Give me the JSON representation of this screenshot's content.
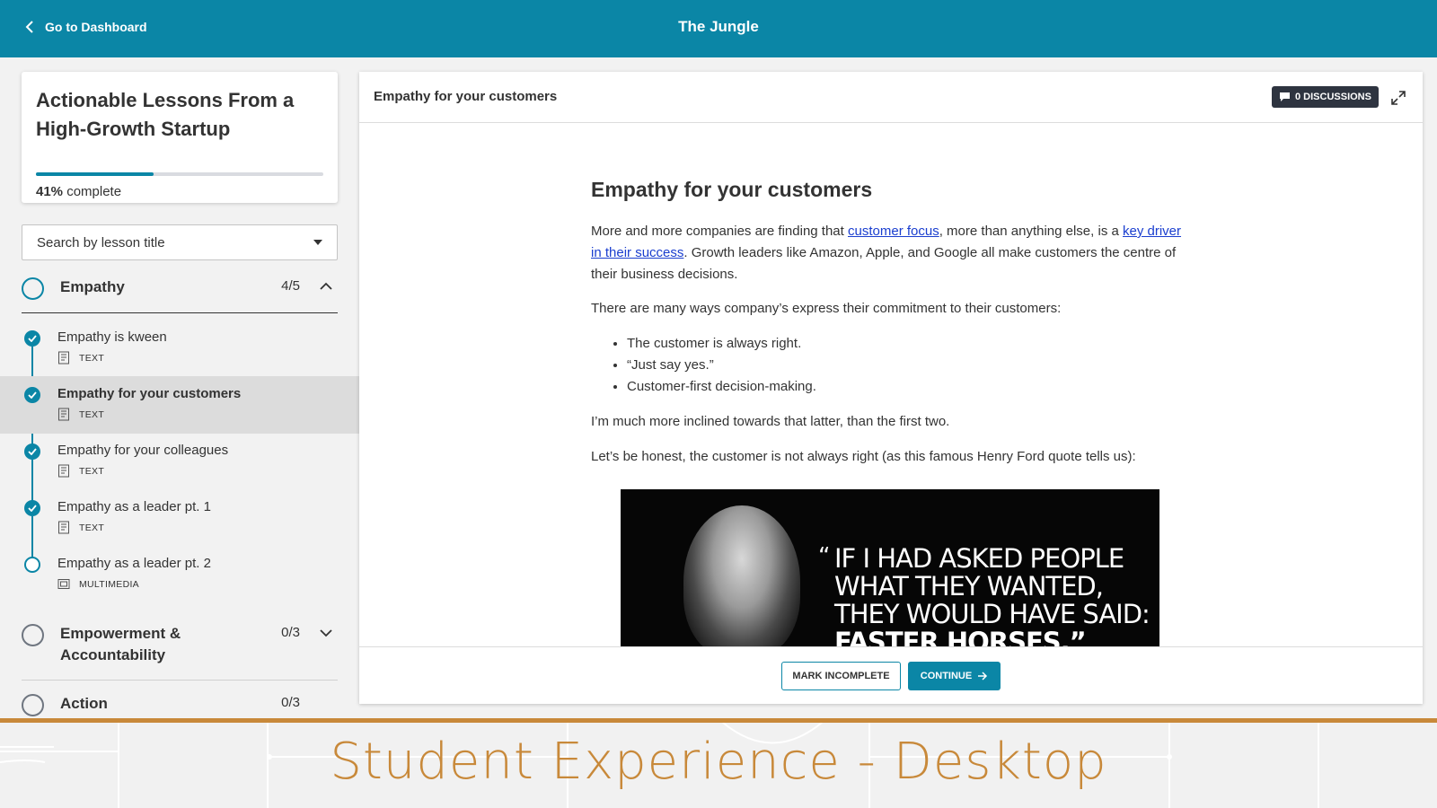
{
  "topbar": {
    "back_label": "Go to Dashboard",
    "course_title": "The Jungle"
  },
  "course": {
    "name": "Actionable Lessons From a High-Growth Startup",
    "progress_percent": 41,
    "progress_value": "41%",
    "progress_suffix": " complete"
  },
  "search": {
    "label": "Search by lesson title"
  },
  "modules": [
    {
      "name": "Empathy",
      "count": "4/5",
      "expanded": true
    },
    {
      "name": "Empowerment & Accountability",
      "count": "0/3",
      "expanded": false
    },
    {
      "name": "Action",
      "count": "0/3",
      "expanded": false
    }
  ],
  "lessons": [
    {
      "title": "Empathy is kween",
      "type": "TEXT",
      "completed": true
    },
    {
      "title": "Empathy for your customers",
      "type": "TEXT",
      "completed": true,
      "current": true
    },
    {
      "title": "Empathy for your colleagues",
      "type": "TEXT",
      "completed": true
    },
    {
      "title": "Empathy as a leader pt. 1",
      "type": "TEXT",
      "completed": true
    },
    {
      "title": "Empathy as a leader pt. 2",
      "type": "MULTIMEDIA",
      "completed": false
    }
  ],
  "content": {
    "header_title": "Empathy for your customers",
    "discussions_label": "0 DISCUSSIONS",
    "article_title": "Empathy for your customers",
    "p1_before": "More and more companies are finding that ",
    "p1_link1": "customer focus",
    "p1_mid": ", more than anything else, is a ",
    "p1_link2": "key driver in their success",
    "p1_after": ". Growth leaders like Amazon, Apple, and Google all make customers the centre of their business decisions.",
    "p2": "There are many ways company’s express their commitment to their customers:",
    "bullets": [
      "The customer is always right.",
      "“Just say yes.”",
      "Customer-first decision-making."
    ],
    "p3": "I’m much more inclined towards that latter, than the first two.",
    "p4": "Let’s be honest, the customer is not always right (as this famous Henry Ford quote tells us):",
    "quote_lines": [
      "IF I HAD ASKED PEOPLE",
      "WHAT THEY WANTED,",
      "THEY WOULD HAVE SAID:",
      "FASTER HORSES.”"
    ],
    "mark_incomplete_label": "MARK INCOMPLETE",
    "continue_label": "CONTINUE"
  },
  "banner": {
    "text": "Student Experience - Desktop",
    "accent_color": "#c8893a"
  },
  "colors": {
    "brand": "#0b86a6",
    "dark_badge": "#2e3440"
  },
  "icons": {
    "back": "chevron-left-icon",
    "module_expanded": "chevron-up-icon",
    "module_collapsed": "chevron-down-icon",
    "lesson_complete": "check-circle-icon",
    "lesson_text": "document-icon",
    "lesson_multimedia": "media-icon",
    "discussions": "chat-bubble-icon",
    "expand": "expand-arrows-icon",
    "continue": "arrow-right-icon"
  }
}
